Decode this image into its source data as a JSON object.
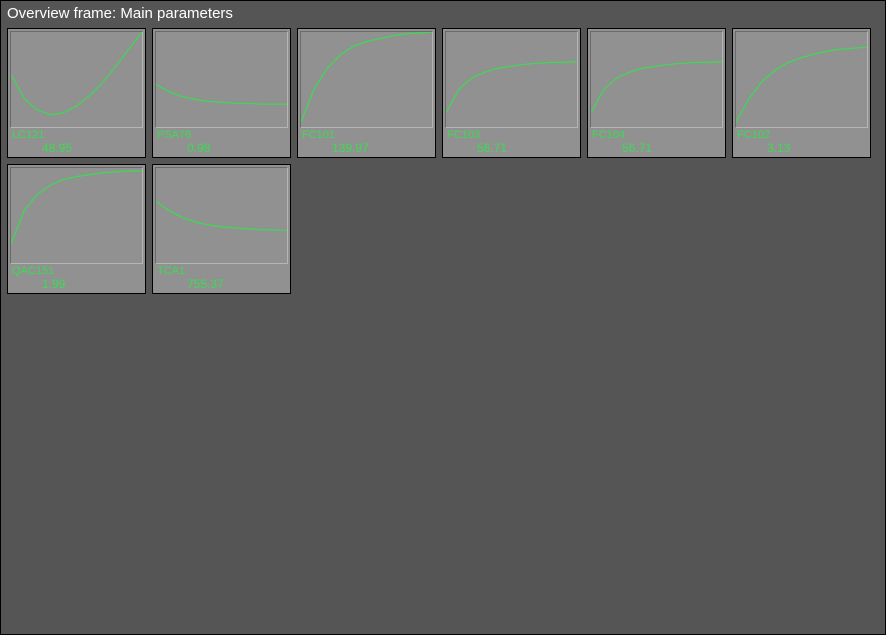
{
  "header": {
    "title": "Overview frame: Main parameters"
  },
  "colors": {
    "background": "#555555",
    "tile_bg": "#919191",
    "line": "#3bdc52",
    "text": "#3bdc52",
    "title_text": "#ffffff"
  },
  "tiles": [
    {
      "label": "LC121",
      "value": "48.95",
      "shape": "dip-rise"
    },
    {
      "label": "PSA76",
      "value": "0.98",
      "shape": "gentle-decline"
    },
    {
      "label": "FC101",
      "value": "139.97",
      "shape": "fast-rise-high"
    },
    {
      "label": "FC103",
      "value": "56.71",
      "shape": "fast-rise-mid"
    },
    {
      "label": "FC104",
      "value": "56.71",
      "shape": "fast-rise-mid"
    },
    {
      "label": "FC102",
      "value": "3.13",
      "shape": "rise-mid-high"
    },
    {
      "label": "QAC151",
      "value": "1.99",
      "shape": "fast-rise-high2"
    },
    {
      "label": "TCA1",
      "value": "755.37",
      "shape": "slow-decline"
    }
  ],
  "chart_data": [
    {
      "type": "line",
      "title": "LC121",
      "xlabel": "",
      "ylabel": "",
      "x": [
        0,
        0.1,
        0.2,
        0.3,
        0.4,
        0.5,
        0.6,
        0.7,
        0.8,
        0.9,
        1.0
      ],
      "values": [
        0.55,
        0.3,
        0.18,
        0.13,
        0.15,
        0.22,
        0.33,
        0.47,
        0.64,
        0.82,
        1.0
      ]
    },
    {
      "type": "line",
      "title": "PSA76",
      "xlabel": "",
      "ylabel": "",
      "x": [
        0,
        0.1,
        0.2,
        0.3,
        0.4,
        0.5,
        0.6,
        0.7,
        0.8,
        0.9,
        1.0
      ],
      "values": [
        0.45,
        0.37,
        0.32,
        0.29,
        0.27,
        0.26,
        0.25,
        0.25,
        0.24,
        0.24,
        0.24
      ]
    },
    {
      "type": "line",
      "title": "FC101",
      "xlabel": "",
      "ylabel": "",
      "x": [
        0,
        0.1,
        0.2,
        0.3,
        0.4,
        0.5,
        0.6,
        0.7,
        0.8,
        0.9,
        1.0
      ],
      "values": [
        0.05,
        0.4,
        0.62,
        0.76,
        0.85,
        0.9,
        0.93,
        0.96,
        0.98,
        0.99,
        1.0
      ]
    },
    {
      "type": "line",
      "title": "FC103",
      "xlabel": "",
      "ylabel": "",
      "x": [
        0,
        0.1,
        0.2,
        0.3,
        0.4,
        0.5,
        0.6,
        0.7,
        0.8,
        0.9,
        1.0
      ],
      "values": [
        0.15,
        0.4,
        0.52,
        0.58,
        0.62,
        0.64,
        0.66,
        0.67,
        0.68,
        0.68,
        0.69
      ]
    },
    {
      "type": "line",
      "title": "FC104",
      "xlabel": "",
      "ylabel": "",
      "x": [
        0,
        0.1,
        0.2,
        0.3,
        0.4,
        0.5,
        0.6,
        0.7,
        0.8,
        0.9,
        1.0
      ],
      "values": [
        0.15,
        0.4,
        0.52,
        0.58,
        0.62,
        0.64,
        0.66,
        0.67,
        0.68,
        0.68,
        0.69
      ]
    },
    {
      "type": "line",
      "title": "FC102",
      "xlabel": "",
      "ylabel": "",
      "x": [
        0,
        0.1,
        0.2,
        0.3,
        0.4,
        0.5,
        0.6,
        0.7,
        0.8,
        0.9,
        1.0
      ],
      "values": [
        0.05,
        0.3,
        0.48,
        0.6,
        0.68,
        0.73,
        0.77,
        0.8,
        0.82,
        0.83,
        0.84
      ]
    },
    {
      "type": "line",
      "title": "QAC151",
      "xlabel": "",
      "ylabel": "",
      "x": [
        0,
        0.1,
        0.2,
        0.3,
        0.4,
        0.5,
        0.6,
        0.7,
        0.8,
        0.9,
        1.0
      ],
      "values": [
        0.2,
        0.55,
        0.72,
        0.82,
        0.88,
        0.91,
        0.93,
        0.95,
        0.96,
        0.97,
        0.97
      ]
    },
    {
      "type": "line",
      "title": "TCA1",
      "xlabel": "",
      "ylabel": "",
      "x": [
        0,
        0.1,
        0.2,
        0.3,
        0.4,
        0.5,
        0.6,
        0.7,
        0.8,
        0.9,
        1.0
      ],
      "values": [
        0.65,
        0.55,
        0.48,
        0.43,
        0.4,
        0.38,
        0.37,
        0.36,
        0.35,
        0.35,
        0.34
      ]
    }
  ]
}
